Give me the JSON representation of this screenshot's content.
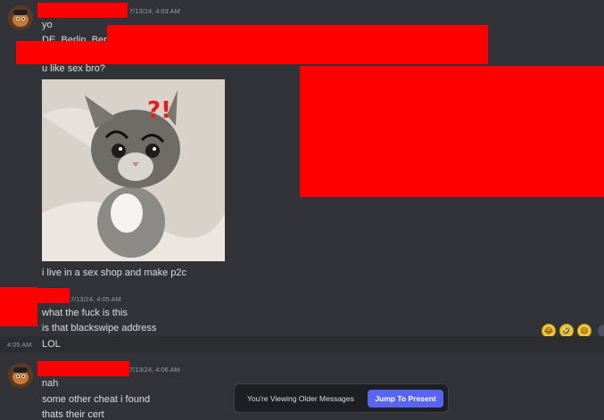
{
  "messages": [
    {
      "timestamp": "7/13/24, 4:03 AM",
      "lines": [
        "yo",
        "DE_Berlin_Berli",
        "u like sex bro?"
      ],
      "caption": "i live in a sex shop and make p2c"
    },
    {
      "timestamp": "7/13/24, 4:05 AM",
      "lines": [
        "what the fuck is this",
        "is that blackswipe address"
      ],
      "hover_time": "4:05 AM",
      "hover_line": "LOL"
    },
    {
      "timestamp": "7/13/24, 4:06 AM",
      "lines": [
        "nah",
        "some other cheat i found",
        "thats their cert"
      ]
    }
  ],
  "image_overlay": {
    "text": "?!"
  },
  "reactions": [
    "joy",
    "rofl",
    "grinning"
  ],
  "older_bar": {
    "text": "You're Viewing Older Messages",
    "button": "Jump To Present"
  },
  "colors": {
    "background": "#313338",
    "redaction": "#ff0000",
    "accent": "#5865f2"
  }
}
